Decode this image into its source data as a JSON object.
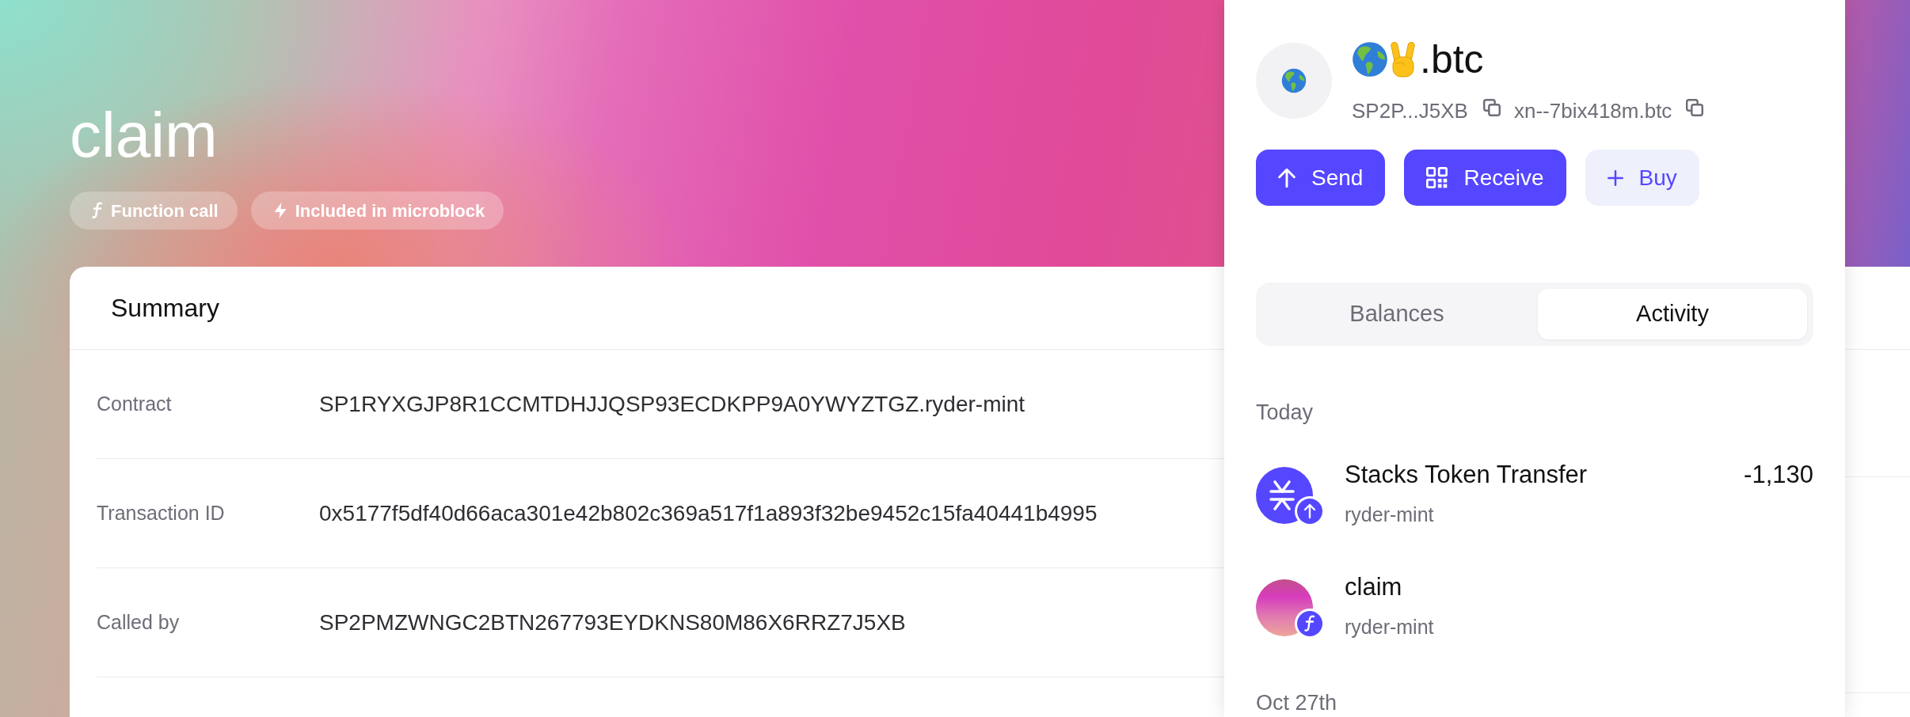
{
  "header": {
    "title": "claim",
    "tags": [
      {
        "kind": "function",
        "label": "Function call"
      },
      {
        "kind": "microblock",
        "label": "Included in microblock"
      }
    ]
  },
  "summary": {
    "title": "Summary",
    "rows": [
      {
        "label": "Contract",
        "value": "SP1RYXGJP8R1CCMTDHJJQSP93ECDKPP9A0YWYZTGZ.ryder-mint"
      },
      {
        "label": "Transaction ID",
        "value": "0x5177f5df40d66aca301e42b802c369a517f1a893f32be9452c15fa40441b4995"
      },
      {
        "label": "Called by",
        "value": "SP2PMZWNGC2BTN267793EYDKNS80M86X6RRZ7J5XB"
      }
    ]
  },
  "wallet": {
    "name": ".btc",
    "address": "SP2P...J5XB",
    "bns_name": "xn--7bix418m.btc",
    "actions": [
      {
        "kind": "send",
        "label": "Send"
      },
      {
        "kind": "receive",
        "label": "Receive"
      },
      {
        "kind": "buy",
        "label": "Buy"
      }
    ],
    "tabs": [
      {
        "label": "Balances",
        "selected": false
      },
      {
        "label": "Activity",
        "selected": true
      }
    ],
    "activity": [
      {
        "date": "Today",
        "items": [
          {
            "kind": "token_transfer",
            "title": "Stacks Token Transfer",
            "subtitle": "ryder-mint",
            "amount": "-1,130"
          },
          {
            "kind": "contract_call",
            "title": "claim",
            "subtitle": "ryder-mint"
          }
        ]
      },
      {
        "date": "Oct 27th"
      }
    ]
  }
}
